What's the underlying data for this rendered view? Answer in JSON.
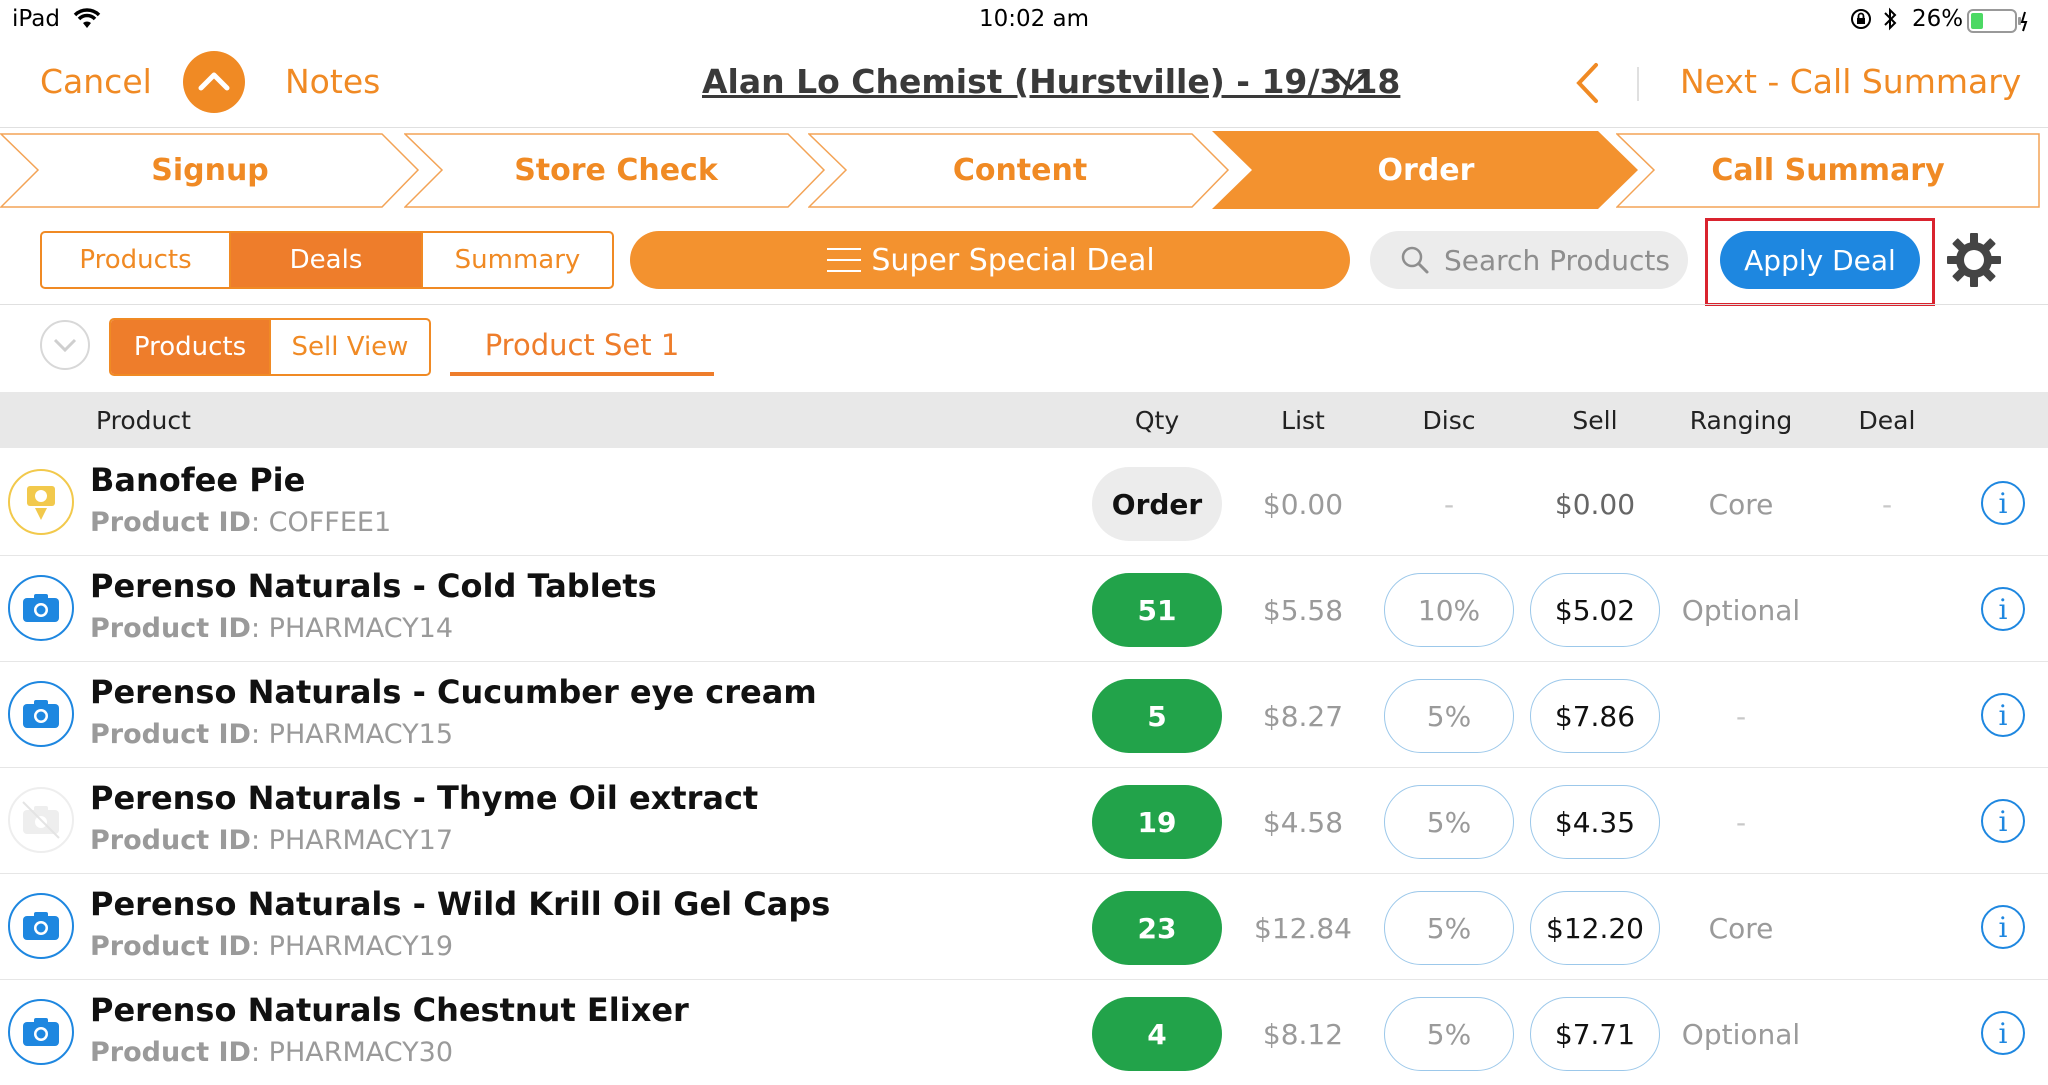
{
  "status_bar": {
    "device": "iPad",
    "time": "10:02 am",
    "battery": "26%"
  },
  "nav": {
    "cancel": "Cancel",
    "notes": "Notes",
    "title": "Alan Lo Chemist (Hurstville) - 19/3/18",
    "next": "Next - Call Summary"
  },
  "steps": [
    "Signup",
    "Store Check",
    "Content",
    "Order",
    "Call Summary"
  ],
  "active_step": "Order",
  "tabs": {
    "products": "Products",
    "deals": "Deals",
    "summary": "Summary"
  },
  "deal_select": "Super Special Deal",
  "search": {
    "placeholder": "Search Products"
  },
  "apply_deal": "Apply Deal",
  "subtabs": {
    "products": "Products",
    "sell_view": "Sell View",
    "product_set": "Product Set 1"
  },
  "table": {
    "headers": {
      "product": "Product",
      "qty": "Qty",
      "list": "List",
      "disc": "Disc",
      "sell": "Sell",
      "ranging": "Ranging",
      "deal": "Deal"
    },
    "id_label": "Product ID",
    "rows": [
      {
        "name": "Banofee Pie",
        "id": "COFFEE1",
        "qty": "Order",
        "list": "$0.00",
        "disc": "-",
        "sell": "$0.00",
        "ranging": "Core",
        "deal": "-"
      },
      {
        "name": "Perenso Naturals - Cold Tablets",
        "id": "PHARMACY14",
        "qty": "51",
        "list": "$5.58",
        "disc": "10%",
        "sell": "$5.02",
        "ranging": "Optional",
        "deal": ""
      },
      {
        "name": "Perenso Naturals - Cucumber eye cream",
        "id": "PHARMACY15",
        "qty": "5",
        "list": "$8.27",
        "disc": "5%",
        "sell": "$7.86",
        "ranging": "-",
        "deal": ""
      },
      {
        "name": "Perenso Naturals - Thyme Oil extract",
        "id": "PHARMACY17",
        "qty": "19",
        "list": "$4.58",
        "disc": "5%",
        "sell": "$4.35",
        "ranging": "-",
        "deal": ""
      },
      {
        "name": "Perenso Naturals - Wild Krill Oil Gel Caps",
        "id": "PHARMACY19",
        "qty": "23",
        "list": "$12.84",
        "disc": "5%",
        "sell": "$12.20",
        "ranging": "Core",
        "deal": ""
      },
      {
        "name": "Perenso Naturals Chestnut Elixer",
        "id": "PHARMACY30",
        "qty": "4",
        "list": "$8.12",
        "disc": "5%",
        "sell": "$7.71",
        "ranging": "Optional",
        "deal": ""
      }
    ]
  },
  "colors": {
    "accent": "#F08A24",
    "primary_blue": "#1E87E0",
    "qty_green": "#22A34A",
    "highlight_red": "#D9232E"
  }
}
